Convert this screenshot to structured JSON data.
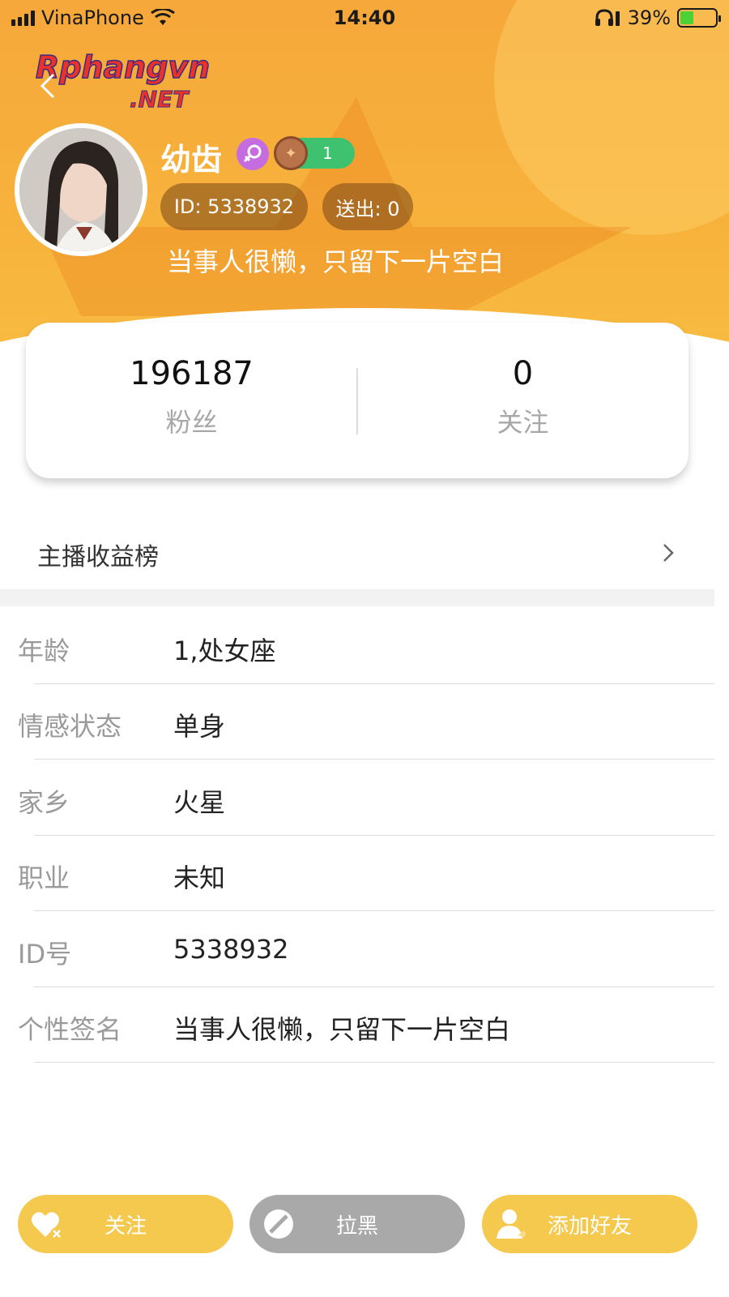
{
  "status_bar": {
    "carrier": "VinaPhone",
    "time": "14:40",
    "battery": "39%",
    "battery_level": 0.39
  },
  "watermark": {
    "brand": "Rphangvn",
    "suffix": ".NET"
  },
  "profile": {
    "nickname": "幼齿",
    "level": "1",
    "id_label": "ID: 5338932",
    "sent_label": "送出: 0",
    "signature": "当事人很懒，只留下一片空白"
  },
  "stats": {
    "fans_value": "196187",
    "fans_label": "粉丝",
    "following_value": "0",
    "following_label": "关注"
  },
  "earnings": {
    "label": "主播收益榜"
  },
  "info": [
    {
      "key": "年龄",
      "value": "1,处女座"
    },
    {
      "key": "情感状态",
      "value": "单身"
    },
    {
      "key": "家乡",
      "value": "火星"
    },
    {
      "key": "职业",
      "value": "未知"
    },
    {
      "key": "ID号",
      "value": "5338932"
    },
    {
      "key": "个性签名",
      "value": "当事人很懒，只留下一片空白"
    }
  ],
  "actions": {
    "follow": "关注",
    "block": "拉黑",
    "add_friend": "添加好友"
  },
  "colors": {
    "accent": "#f5c94e",
    "header": "#f7b23c",
    "block_button": "#a9a9a9"
  },
  "icons": {
    "back": "back-arrow-icon",
    "gender": "female-icon",
    "coin": "coin-icon",
    "chevron": "chevron-right-icon",
    "follow": "heart-icon",
    "block": "block-icon",
    "add_friend": "add-user-icon"
  }
}
